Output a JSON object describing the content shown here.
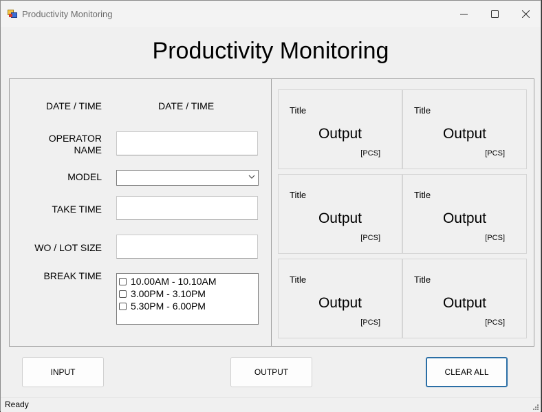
{
  "window": {
    "title": "Productivity Monitoring",
    "controls": {
      "minimize": "minimize",
      "maximize": "maximize",
      "close": "close"
    }
  },
  "heading": "Productivity Monitoring",
  "form": {
    "datetime_label": "DATE / TIME",
    "datetime_value": "DATE / TIME",
    "operator_label_line1": "OPERATOR",
    "operator_label_line2": "NAME",
    "operator_value": "",
    "model_label": "MODEL",
    "model_value": "",
    "take_time_label": "TAKE TIME",
    "take_time_value": "",
    "wo_lot_label": "WO / LOT SIZE",
    "wo_lot_value": "",
    "break_time_label": "BREAK TIME",
    "break_times": [
      {
        "label": "10.00AM - 10.10AM",
        "checked": false
      },
      {
        "label": "3.00PM - 3.10PM",
        "checked": false
      },
      {
        "label": "5.30PM - 6.00PM",
        "checked": false
      }
    ]
  },
  "outputs": [
    {
      "title": "Title",
      "value": "Output",
      "unit": "[PCS]"
    },
    {
      "title": "Title",
      "value": "Output",
      "unit": "[PCS]"
    },
    {
      "title": "Title",
      "value": "Output",
      "unit": "[PCS]"
    },
    {
      "title": "Title",
      "value": "Output",
      "unit": "[PCS]"
    },
    {
      "title": "Title",
      "value": "Output",
      "unit": "[PCS]"
    },
    {
      "title": "Title",
      "value": "Output",
      "unit": "[PCS]"
    }
  ],
  "buttons": {
    "input": "INPUT",
    "output": "OUTPUT",
    "clear_all": "CLEAR ALL"
  },
  "status": "Ready",
  "colors": {
    "window_bg": "#f0f0f0",
    "accent_border": "#2a6ea5"
  }
}
